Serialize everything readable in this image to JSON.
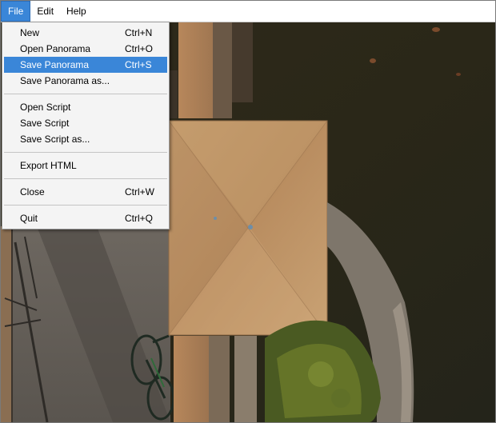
{
  "menubar": {
    "items": [
      {
        "label": "File",
        "active": true
      },
      {
        "label": "Edit",
        "active": false
      },
      {
        "label": "Help",
        "active": false
      }
    ]
  },
  "file_menu": {
    "groups": [
      [
        {
          "label": "New",
          "accelerator": "Ctrl+N"
        },
        {
          "label": "Open Panorama",
          "accelerator": "Ctrl+O"
        },
        {
          "label": "Save Panorama",
          "accelerator": "Ctrl+S",
          "selected": true
        },
        {
          "label": "Save Panorama as...",
          "accelerator": ""
        }
      ],
      [
        {
          "label": "Open Script",
          "accelerator": ""
        },
        {
          "label": "Save Script",
          "accelerator": ""
        },
        {
          "label": "Save Script as...",
          "accelerator": ""
        }
      ],
      [
        {
          "label": "Export HTML",
          "accelerator": ""
        }
      ],
      [
        {
          "label": "Close",
          "accelerator": "Ctrl+W"
        }
      ],
      [
        {
          "label": "Quit",
          "accelerator": "Ctrl+Q"
        }
      ]
    ]
  },
  "colors": {
    "selection": "#3a86d8",
    "menu_bg": "#f4f4f4",
    "water": "#2b2819",
    "stone": "#c09468"
  }
}
